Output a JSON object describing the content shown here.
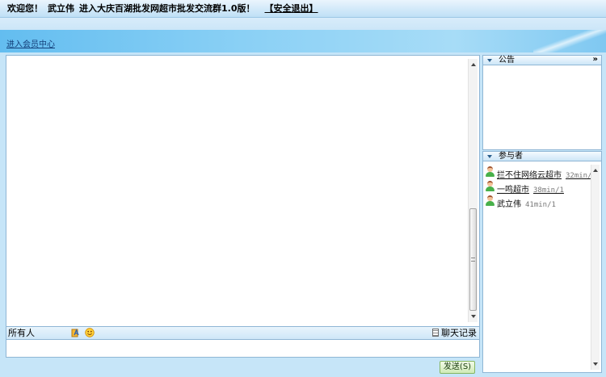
{
  "header": {
    "welcome": "欢迎您！",
    "username": "武立伟",
    "room_title": "进入大庆百湖批发网超市批发交流群1.0版！",
    "logout_label": "【安全退出】"
  },
  "nav": {
    "member_center_link": "进入会员中心"
  },
  "chat": {
    "recipient_label": "所有人",
    "history_label": "聊天记录",
    "input_value": "",
    "send_label": "发送(S)"
  },
  "notice": {
    "title": "公告",
    "more_label": "»"
  },
  "members": {
    "title": "参与者",
    "list": [
      {
        "name": "拦不住网络云超市",
        "stat": "32min/0",
        "link": true
      },
      {
        "name": "一鸣超市",
        "stat": "38min/1",
        "link": true
      },
      {
        "name": "武立伟",
        "stat": "41min/1",
        "link": false
      }
    ]
  },
  "icons": {
    "font_color_tool": "font-icon",
    "emoticon_tool": "smiley-icon",
    "history_icon": "document-icon",
    "member_avatar": "user-avatar-icon",
    "collapse_arrow": "triangle-down-icon"
  },
  "colors": {
    "page_bg": "#c6e5f8",
    "nav_bar": "#7fc8f1",
    "panel_border": "#8fb6d5",
    "send_button": "#cfeab6"
  }
}
